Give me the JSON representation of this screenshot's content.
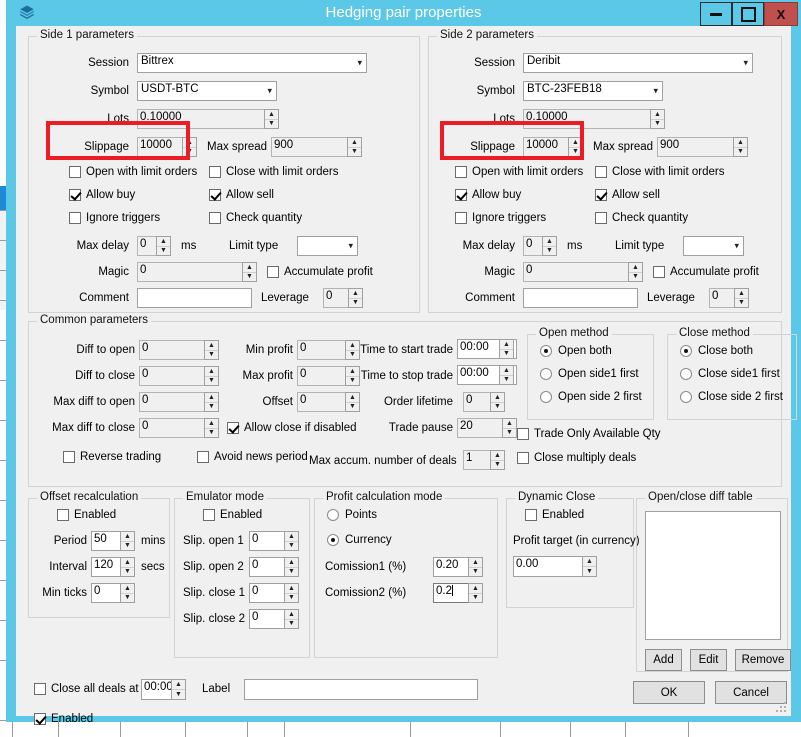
{
  "window": {
    "title": "Hedging pair properties",
    "icon": "cube-icon",
    "minimize_label": "minimize",
    "maximize_label": "maximize",
    "close_label": "X",
    "titlebar_color": "#5bc8e8",
    "close_color": "#c0504d"
  },
  "annotation": {
    "color": "#ed1c24",
    "boxes": [
      "side1-slippage",
      "side2-slippage"
    ]
  },
  "side1": {
    "title": "Side 1 parameters",
    "session_label": "Session",
    "session_value": "Bittrex",
    "symbol_label": "Symbol",
    "symbol_value": "USDT-BTC",
    "lots_label": "Lots",
    "lots_value": "0.10000",
    "slippage_label": "Slippage",
    "slippage_value": "10000",
    "max_spread_label": "Max spread",
    "max_spread_value": "900",
    "open_with_limit_orders": {
      "label": "Open with limit orders",
      "checked": false
    },
    "close_with_limit_orders": {
      "label": "Close with limit orders",
      "checked": false
    },
    "allow_buy": {
      "label": "Allow buy",
      "checked": true
    },
    "allow_sell": {
      "label": "Allow sell",
      "checked": true
    },
    "ignore_triggers": {
      "label": "Ignore triggers",
      "checked": false
    },
    "check_quantity": {
      "label": "Check quantity",
      "checked": false
    },
    "max_delay_label": "Max delay",
    "max_delay_value": "0",
    "ms_label": "ms",
    "limit_type_label": "Limit type",
    "limit_type_value": "",
    "magic_label": "Magic",
    "magic_value": "0",
    "accumulate_profit": {
      "label": "Accumulate profit",
      "checked": false
    },
    "comment_label": "Comment",
    "comment_value": "",
    "leverage_label": "Leverage",
    "leverage_value": "0"
  },
  "side2": {
    "title": "Side 2 parameters",
    "session_label": "Session",
    "session_value": "Deribit",
    "symbol_label": "Symbol",
    "symbol_value": "BTC-23FEB18",
    "lots_label": "Lots",
    "lots_value": "0.10000",
    "slippage_label": "Slippage",
    "slippage_value": "10000",
    "max_spread_label": "Max spread",
    "max_spread_value": "900",
    "open_with_limit_orders": {
      "label": "Open with limit orders",
      "checked": false
    },
    "close_with_limit_orders": {
      "label": "Close with limit orders",
      "checked": false
    },
    "allow_buy": {
      "label": "Allow buy",
      "checked": true
    },
    "allow_sell": {
      "label": "Allow sell",
      "checked": true
    },
    "ignore_triggers": {
      "label": "Ignore triggers",
      "checked": false
    },
    "check_quantity": {
      "label": "Check quantity",
      "checked": false
    },
    "max_delay_label": "Max delay",
    "max_delay_value": "0",
    "ms_label": "ms",
    "limit_type_label": "Limit type",
    "limit_type_value": "",
    "magic_label": "Magic",
    "magic_value": "0",
    "accumulate_profit": {
      "label": "Accumulate profit",
      "checked": false
    },
    "comment_label": "Comment",
    "comment_value": "",
    "leverage_label": "Leverage",
    "leverage_value": "0"
  },
  "common": {
    "title": "Common parameters",
    "diff_to_open_label": "Diff to open",
    "diff_to_open_value": "0",
    "diff_to_close_label": "Diff to close",
    "diff_to_close_value": "0",
    "max_diff_to_open_label": "Max diff to open",
    "max_diff_to_open_value": "0",
    "max_diff_to_close_label": "Max diff to close",
    "max_diff_to_close_value": "0",
    "min_profit_label": "Min profit",
    "min_profit_value": "0",
    "max_profit_label": "Max profit",
    "max_profit_value": "0",
    "offset_label": "Offset",
    "offset_value": "0",
    "allow_close_if_disabled": {
      "label": "Allow close if disabled",
      "checked": true
    },
    "reverse_trading": {
      "label": "Reverse trading",
      "checked": false
    },
    "avoid_news_period": {
      "label": "Avoid news period",
      "checked": false
    },
    "time_to_start_trade_label": "Time to start trade",
    "time_to_start_trade_value": "00:00",
    "time_to_stop_trade_label": "Time to stop trade",
    "time_to_stop_trade_value": "00:00",
    "order_lifetime_label": "Order lifetime",
    "order_lifetime_value": "0",
    "trade_pause_label": "Trade pause",
    "trade_pause_value": "20",
    "max_accum_deals_label": "Max accum. number of deals",
    "max_accum_deals_value": "1",
    "open_method": {
      "title": "Open method",
      "options": [
        "Open both",
        "Open side1 first",
        "Open side 2 first"
      ],
      "selected": 0
    },
    "close_method": {
      "title": "Close method",
      "options": [
        "Close both",
        "Close side1 first",
        "Close side 2 first"
      ],
      "selected": 0
    },
    "trade_only_available_qty": {
      "label": "Trade Only Available Qty",
      "checked": false
    },
    "close_multiply_deals": {
      "label": "Close multiply deals",
      "checked": false
    }
  },
  "offset_recalculation": {
    "title": "Offset recalculation",
    "enabled": {
      "label": "Enabled",
      "checked": false
    },
    "period_label": "Period",
    "period_value": "50",
    "period_unit": "mins",
    "interval_label": "Interval",
    "interval_value": "120",
    "interval_unit": "secs",
    "min_ticks_label": "Min ticks",
    "min_ticks_value": "0"
  },
  "emulator_mode": {
    "title": "Emulator mode",
    "enabled": {
      "label": "Enabled",
      "checked": false
    },
    "slip_open_1_label": "Slip. open 1",
    "slip_open_1_value": "0",
    "slip_open_2_label": "Slip. open 2",
    "slip_open_2_value": "0",
    "slip_close_1_label": "Slip. close 1",
    "slip_close_1_value": "0",
    "slip_close_2_label": "Slip. close 2",
    "slip_close_2_value": "0"
  },
  "profit_calculation_mode": {
    "title": "Profit calculation mode",
    "options": [
      "Points",
      "Currency"
    ],
    "selected": 1,
    "commission1_label": "Comission1 (%)",
    "commission1_value": "0.20",
    "commission2_label": "Comission2 (%)",
    "commission2_value": "0.2",
    "commission2_focused": true
  },
  "dynamic_close": {
    "title": "Dynamic Close",
    "enabled": {
      "label": "Enabled",
      "checked": false
    },
    "profit_target_label": "Profit target (in currency)",
    "profit_target_value": "0.00"
  },
  "diff_table": {
    "title": "Open/close diff table",
    "rows": [],
    "add_label": "Add",
    "edit_label": "Edit",
    "remove_label": "Remove"
  },
  "footer": {
    "close_all_deals_at": {
      "label": "Close all deals at",
      "checked": false
    },
    "close_all_deals_time": "00:00",
    "label_caption": "Label",
    "label_value": "",
    "enabled": {
      "label": "Enabled",
      "checked": true
    },
    "ok_label": "OK",
    "cancel_label": "Cancel"
  }
}
